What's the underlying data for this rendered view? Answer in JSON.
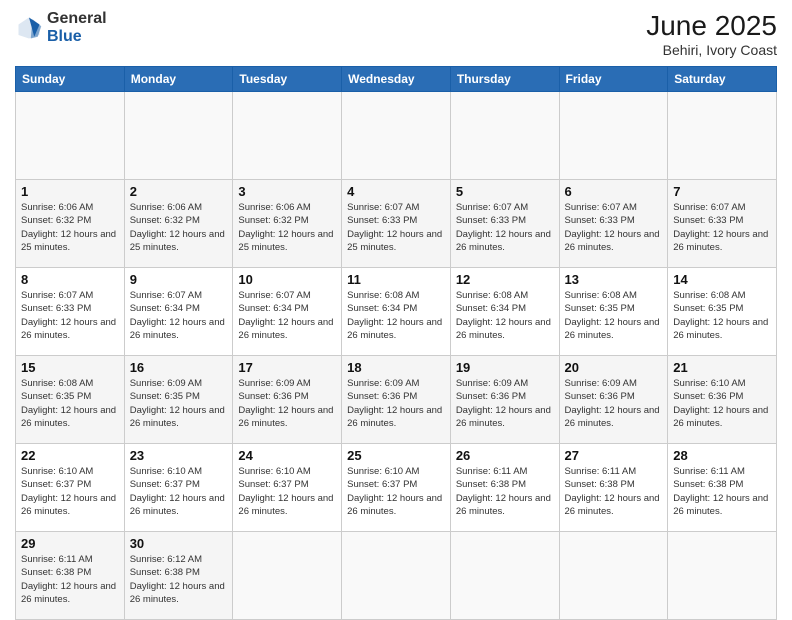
{
  "header": {
    "logo_general": "General",
    "logo_blue": "Blue",
    "title": "June 2025",
    "subtitle": "Behiri, Ivory Coast"
  },
  "calendar": {
    "days_of_week": [
      "Sunday",
      "Monday",
      "Tuesday",
      "Wednesday",
      "Thursday",
      "Friday",
      "Saturday"
    ],
    "weeks": [
      [
        {
          "day": "",
          "info": ""
        },
        {
          "day": "",
          "info": ""
        },
        {
          "day": "",
          "info": ""
        },
        {
          "day": "",
          "info": ""
        },
        {
          "day": "",
          "info": ""
        },
        {
          "day": "",
          "info": ""
        },
        {
          "day": "",
          "info": ""
        }
      ],
      [
        {
          "day": "1",
          "sunrise": "6:06 AM",
          "sunset": "6:32 PM",
          "daylight": "12 hours and 25 minutes."
        },
        {
          "day": "2",
          "sunrise": "6:06 AM",
          "sunset": "6:32 PM",
          "daylight": "12 hours and 25 minutes."
        },
        {
          "day": "3",
          "sunrise": "6:06 AM",
          "sunset": "6:32 PM",
          "daylight": "12 hours and 25 minutes."
        },
        {
          "day": "4",
          "sunrise": "6:07 AM",
          "sunset": "6:33 PM",
          "daylight": "12 hours and 25 minutes."
        },
        {
          "day": "5",
          "sunrise": "6:07 AM",
          "sunset": "6:33 PM",
          "daylight": "12 hours and 26 minutes."
        },
        {
          "day": "6",
          "sunrise": "6:07 AM",
          "sunset": "6:33 PM",
          "daylight": "12 hours and 26 minutes."
        },
        {
          "day": "7",
          "sunrise": "6:07 AM",
          "sunset": "6:33 PM",
          "daylight": "12 hours and 26 minutes."
        }
      ],
      [
        {
          "day": "8",
          "sunrise": "6:07 AM",
          "sunset": "6:33 PM",
          "daylight": "12 hours and 26 minutes."
        },
        {
          "day": "9",
          "sunrise": "6:07 AM",
          "sunset": "6:34 PM",
          "daylight": "12 hours and 26 minutes."
        },
        {
          "day": "10",
          "sunrise": "6:07 AM",
          "sunset": "6:34 PM",
          "daylight": "12 hours and 26 minutes."
        },
        {
          "day": "11",
          "sunrise": "6:08 AM",
          "sunset": "6:34 PM",
          "daylight": "12 hours and 26 minutes."
        },
        {
          "day": "12",
          "sunrise": "6:08 AM",
          "sunset": "6:34 PM",
          "daylight": "12 hours and 26 minutes."
        },
        {
          "day": "13",
          "sunrise": "6:08 AM",
          "sunset": "6:35 PM",
          "daylight": "12 hours and 26 minutes."
        },
        {
          "day": "14",
          "sunrise": "6:08 AM",
          "sunset": "6:35 PM",
          "daylight": "12 hours and 26 minutes."
        }
      ],
      [
        {
          "day": "15",
          "sunrise": "6:08 AM",
          "sunset": "6:35 PM",
          "daylight": "12 hours and 26 minutes."
        },
        {
          "day": "16",
          "sunrise": "6:09 AM",
          "sunset": "6:35 PM",
          "daylight": "12 hours and 26 minutes."
        },
        {
          "day": "17",
          "sunrise": "6:09 AM",
          "sunset": "6:36 PM",
          "daylight": "12 hours and 26 minutes."
        },
        {
          "day": "18",
          "sunrise": "6:09 AM",
          "sunset": "6:36 PM",
          "daylight": "12 hours and 26 minutes."
        },
        {
          "day": "19",
          "sunrise": "6:09 AM",
          "sunset": "6:36 PM",
          "daylight": "12 hours and 26 minutes."
        },
        {
          "day": "20",
          "sunrise": "6:09 AM",
          "sunset": "6:36 PM",
          "daylight": "12 hours and 26 minutes."
        },
        {
          "day": "21",
          "sunrise": "6:10 AM",
          "sunset": "6:36 PM",
          "daylight": "12 hours and 26 minutes."
        }
      ],
      [
        {
          "day": "22",
          "sunrise": "6:10 AM",
          "sunset": "6:37 PM",
          "daylight": "12 hours and 26 minutes."
        },
        {
          "day": "23",
          "sunrise": "6:10 AM",
          "sunset": "6:37 PM",
          "daylight": "12 hours and 26 minutes."
        },
        {
          "day": "24",
          "sunrise": "6:10 AM",
          "sunset": "6:37 PM",
          "daylight": "12 hours and 26 minutes."
        },
        {
          "day": "25",
          "sunrise": "6:10 AM",
          "sunset": "6:37 PM",
          "daylight": "12 hours and 26 minutes."
        },
        {
          "day": "26",
          "sunrise": "6:11 AM",
          "sunset": "6:38 PM",
          "daylight": "12 hours and 26 minutes."
        },
        {
          "day": "27",
          "sunrise": "6:11 AM",
          "sunset": "6:38 PM",
          "daylight": "12 hours and 26 minutes."
        },
        {
          "day": "28",
          "sunrise": "6:11 AM",
          "sunset": "6:38 PM",
          "daylight": "12 hours and 26 minutes."
        }
      ],
      [
        {
          "day": "29",
          "sunrise": "6:11 AM",
          "sunset": "6:38 PM",
          "daylight": "12 hours and 26 minutes."
        },
        {
          "day": "30",
          "sunrise": "6:12 AM",
          "sunset": "6:38 PM",
          "daylight": "12 hours and 26 minutes."
        },
        {
          "day": "",
          "info": ""
        },
        {
          "day": "",
          "info": ""
        },
        {
          "day": "",
          "info": ""
        },
        {
          "day": "",
          "info": ""
        },
        {
          "day": "",
          "info": ""
        }
      ]
    ]
  }
}
